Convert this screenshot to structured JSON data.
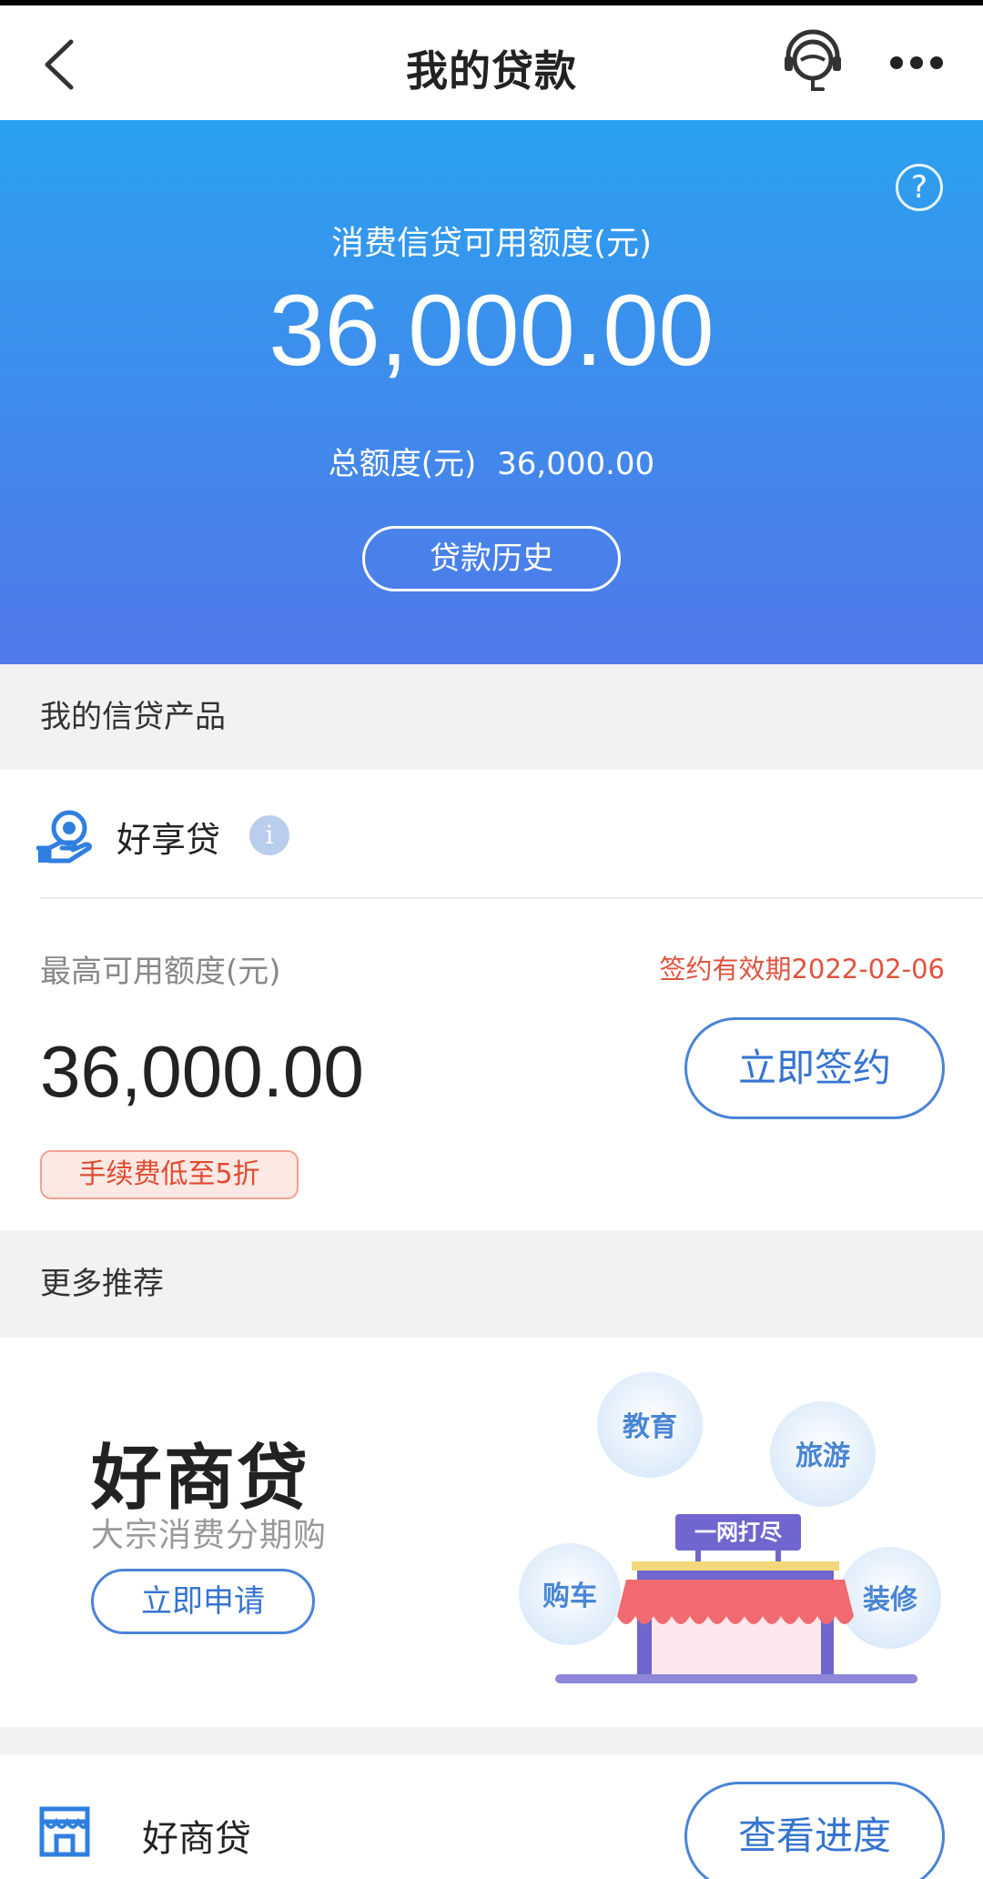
{
  "nav": {
    "title": "我的贷款"
  },
  "banner": {
    "available_label": "消费信贷可用额度(元)",
    "available_amount": "36,000.00",
    "total_label": "总额度(元)",
    "total_amount": "36,000.00",
    "history_button": "贷款历史",
    "help_glyph": "?"
  },
  "products_section": {
    "title": "我的信贷产品"
  },
  "product": {
    "name": "好享贷",
    "info_glyph": "i",
    "max_label": "最高可用额度(元)",
    "expiry_text": "签约有效期2022-02-06",
    "max_amount": "36,000.00",
    "sign_button": "立即签约",
    "fee_badge": "手续费低至5折"
  },
  "more_section": {
    "title": "更多推荐"
  },
  "promo": {
    "title": "好商贷",
    "subtitle": "大宗消费分期购",
    "apply_button": "立即申请",
    "illustration": {
      "sign": "一网打尽",
      "bubbles": [
        "教育",
        "旅游",
        "购车",
        "装修"
      ]
    }
  },
  "bottom_item": {
    "name": "好商贷",
    "progress_button": "查看进度"
  },
  "colors": {
    "accent_blue": "#3574d0",
    "banner_top": "#2aa1ef",
    "banner_bottom": "#5079e9",
    "warning_red": "#e0533f"
  },
  "icons": {
    "back": "chevron-left-icon",
    "service": "customer-service-icon",
    "more": "more-dots-icon",
    "help": "question-circle-icon",
    "product": "hand-coin-icon",
    "info": "info-icon",
    "store": "store-icon"
  }
}
